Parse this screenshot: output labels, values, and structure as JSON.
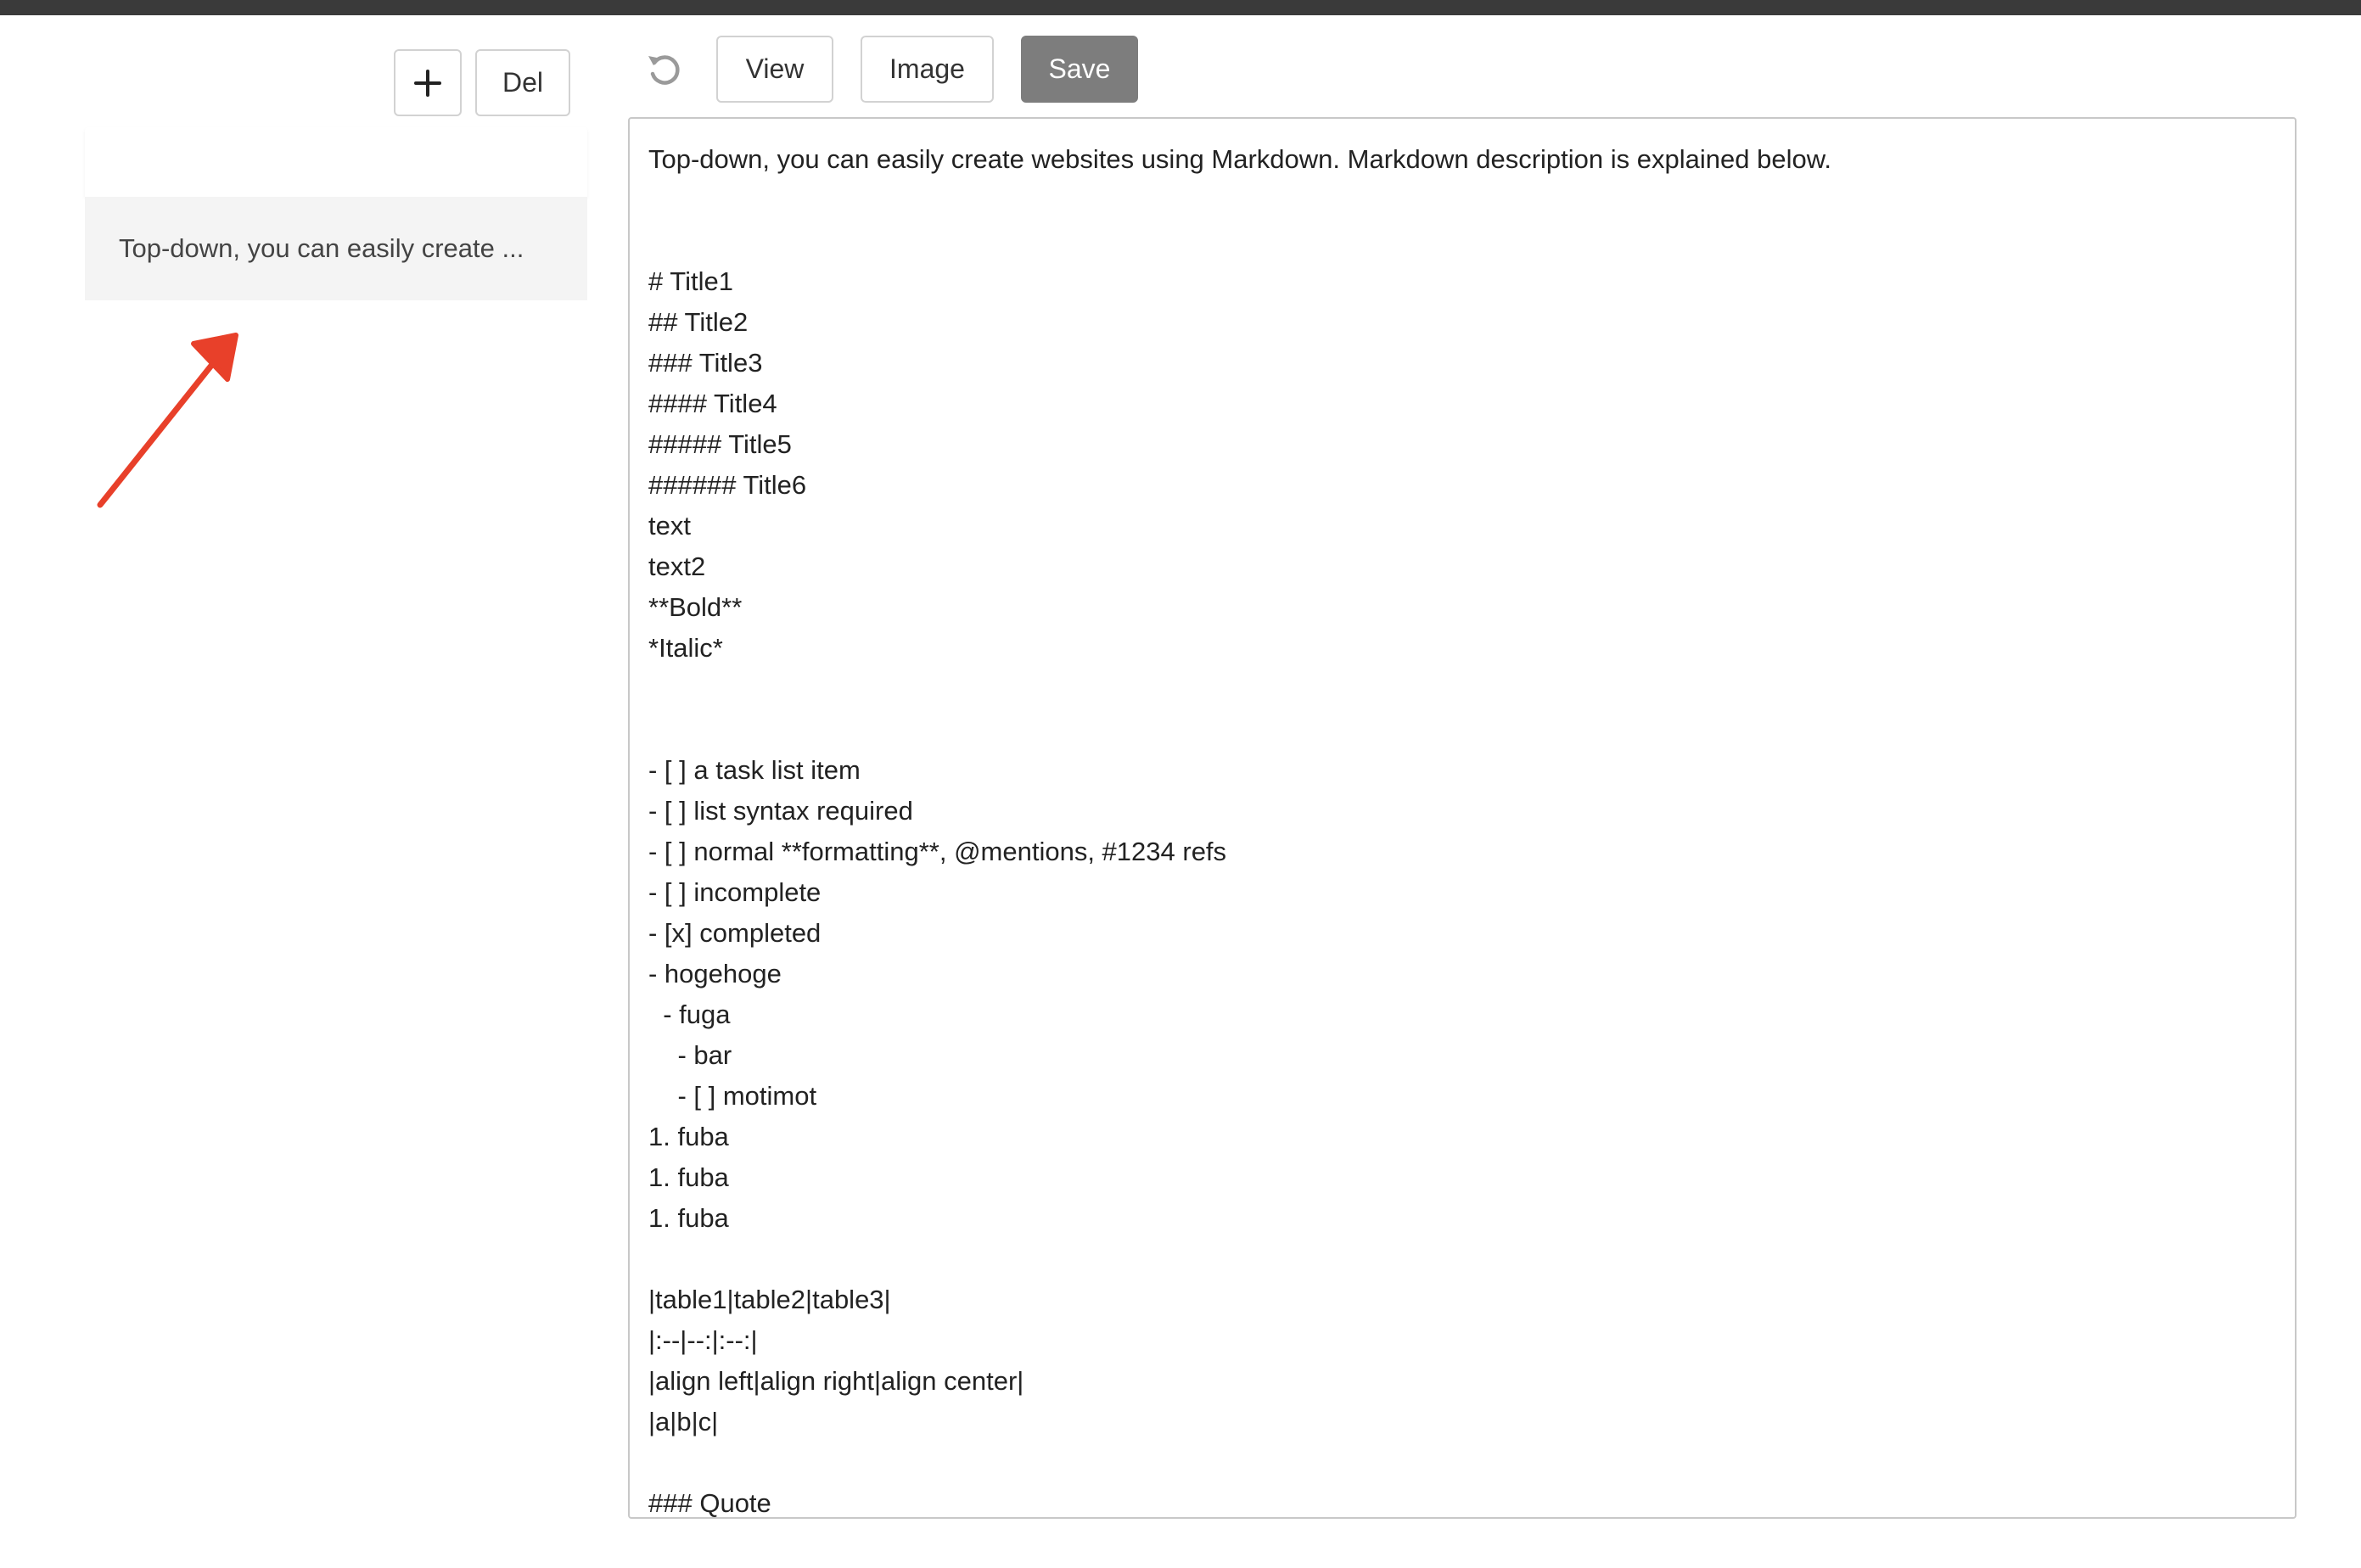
{
  "sidebar": {
    "add_label": "+",
    "del_label": "Del",
    "notes": [
      {
        "preview": ""
      },
      {
        "preview": "Top-down, you can easily create ..."
      }
    ]
  },
  "toolbar": {
    "undo_icon": "undo-icon",
    "view_label": "View",
    "image_label": "Image",
    "save_label": "Save"
  },
  "editor": {
    "content": "Top-down, you can easily create websites using Markdown. Markdown description is explained below.\n\n\n# Title1\n## Title2\n### Title3\n#### Title4\n##### Title5\n###### Title6\ntext\ntext2\n**Bold**\n*Italic*\n\n\n- [ ] a task list item\n- [ ] list syntax required\n- [ ] normal **formatting**, @mentions, #1234 refs\n- [ ] incomplete\n- [x] completed\n- hogehoge\n  - fuga\n    - bar\n    - [ ] motimot\n1. fuba\n1. fuba\n1. fuba\n\n|table1|table2|table3|\n|:--|--:|:--:|\n|align left|align right|align center|\n|a|b|c|\n\n### Quote"
  },
  "colors": {
    "topbar": "#3a3a3a",
    "save_bg": "#7d7d7d",
    "annotation_arrow": "#e8402a",
    "selected_note_bg": "#f4f4f4"
  }
}
